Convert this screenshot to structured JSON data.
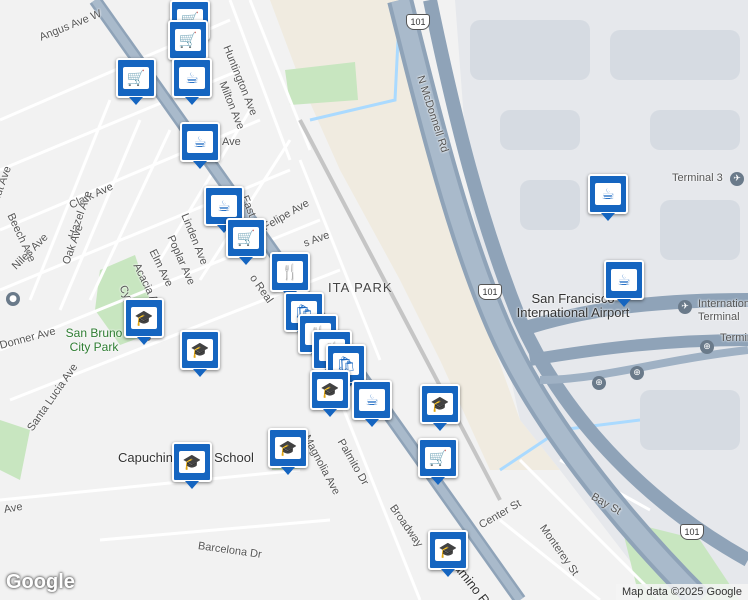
{
  "map": {
    "highway_label": "101",
    "area_label": "ITA PARK",
    "streets": [
      {
        "key": "angus",
        "text": "Angus Ave W"
      },
      {
        "key": "huntington",
        "text": "Huntington Ave"
      },
      {
        "key": "milton",
        "text": "Milton Ave"
      },
      {
        "key": "mcdonnell",
        "text": "N McDonnell Rd"
      },
      {
        "key": "ave",
        "text": "Ave"
      },
      {
        "key": "clark",
        "text": "Clark Ave"
      },
      {
        "key": "beech",
        "text": "Beech Ave"
      },
      {
        "key": "chestnut",
        "text": "Chestnut Ave"
      },
      {
        "key": "hazel",
        "text": "Hazel Ave"
      },
      {
        "key": "niles",
        "text": "Niles Ave"
      },
      {
        "key": "oak",
        "text": "Oak Ave"
      },
      {
        "key": "linden",
        "text": "Linden Ave"
      },
      {
        "key": "poplar",
        "text": "Poplar Ave"
      },
      {
        "key": "elm",
        "text": "Elm Ave"
      },
      {
        "key": "acacia",
        "text": "Acacia Ave"
      },
      {
        "key": "cypress",
        "text": "Cypress Ave"
      },
      {
        "key": "east",
        "text": "East Ave"
      },
      {
        "key": "felipe",
        "text": "Felipe Ave"
      },
      {
        "key": "sa",
        "text": "s Ave"
      },
      {
        "key": "real",
        "text": "o Real"
      },
      {
        "key": "donner",
        "text": "Donner Ave"
      },
      {
        "key": "santa_lucia",
        "text": "Santa Lucia Ave"
      },
      {
        "key": "magnolia",
        "text": "Magnolia Ave"
      },
      {
        "key": "palmito",
        "text": "Palmito Dr"
      },
      {
        "key": "broadway",
        "text": "Broadway"
      },
      {
        "key": "el_camino",
        "text": "El Camino Real"
      },
      {
        "key": "center",
        "text": "Center St"
      },
      {
        "key": "monterey",
        "text": "Monterey St"
      },
      {
        "key": "bay",
        "text": "Bay St"
      },
      {
        "key": "barcelona",
        "text": "Barcelona Dr"
      },
      {
        "key": "ave_sw",
        "text": "Ave"
      }
    ],
    "places": {
      "san_bruno_park": "San Bruno City Park",
      "capuchino": "Capuchino High School",
      "sfo": "San Francisco International Airport",
      "terminal3": "Terminal 3",
      "intl_terminal": "International Terminal",
      "terminal": "Terminal"
    },
    "pins": [
      {
        "type": "grocery",
        "icon": "🛒"
      },
      {
        "type": "grocery",
        "icon": "🛒"
      },
      {
        "type": "grocery",
        "icon": "🛒"
      },
      {
        "type": "grocery",
        "icon": "🛒"
      },
      {
        "type": "cafe",
        "icon": "☕"
      },
      {
        "type": "cafe",
        "icon": "☕"
      },
      {
        "type": "cafe",
        "icon": "☕"
      },
      {
        "type": "grocery",
        "icon": "🛒"
      },
      {
        "type": "restaurant",
        "icon": "🍴"
      },
      {
        "type": "shopping",
        "icon": "🛍"
      },
      {
        "type": "school",
        "icon": "🎓"
      },
      {
        "type": "school",
        "icon": "🎓"
      },
      {
        "type": "school",
        "icon": "🎓"
      },
      {
        "type": "cafe",
        "icon": "☕"
      },
      {
        "type": "school",
        "icon": "🎓"
      },
      {
        "type": "school",
        "icon": "🎓"
      },
      {
        "type": "school",
        "icon": "🎓"
      },
      {
        "type": "grocery",
        "icon": "🛒"
      },
      {
        "type": "school",
        "icon": "🎓"
      },
      {
        "type": "cafe",
        "icon": "☕"
      },
      {
        "type": "cafe",
        "icon": "☕"
      },
      {
        "type": "restaurant",
        "icon": "🍴"
      }
    ],
    "google_logo": "Google",
    "attribution": "Map data ©2025 Google",
    "colors": {
      "water": "#aadaff",
      "highway": "#8fa3b8",
      "sand": "#f0ebe0",
      "park": "#c8e6c0",
      "pin": "#1565c0"
    }
  }
}
